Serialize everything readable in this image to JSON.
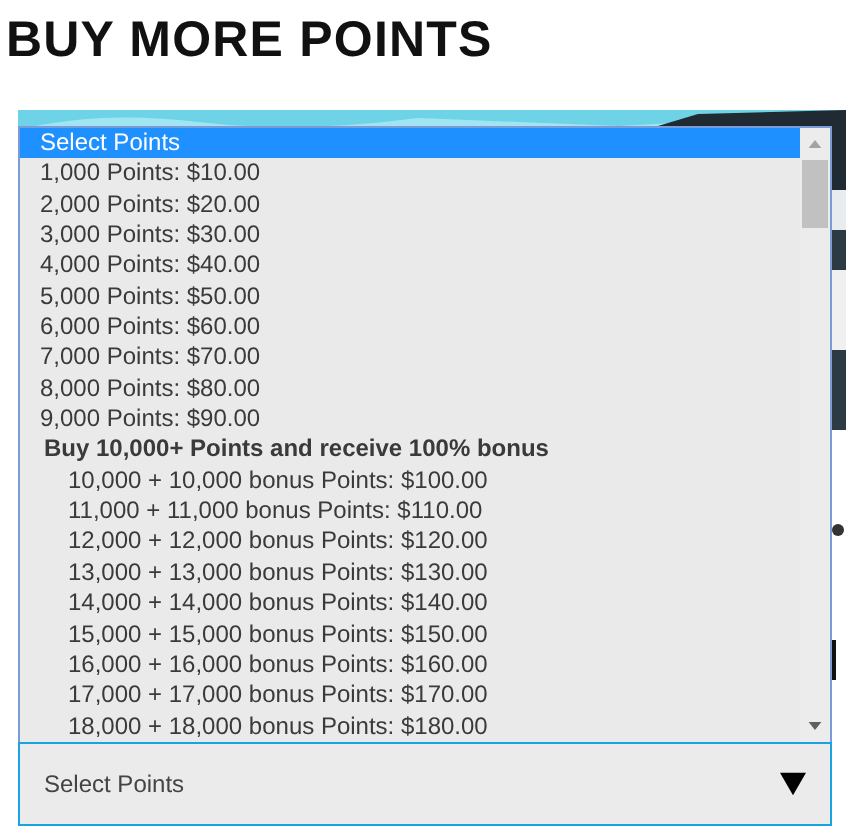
{
  "heading": "BUY MORE POINTS",
  "dropdown_list": {
    "options": [
      {
        "kind": "option",
        "label": "Select Points",
        "selected": true
      },
      {
        "kind": "option",
        "label": "1,000 Points: $10.00",
        "selected": false
      },
      {
        "kind": "option",
        "label": "2,000 Points: $20.00",
        "selected": false
      },
      {
        "kind": "option",
        "label": "3,000 Points: $30.00",
        "selected": false
      },
      {
        "kind": "option",
        "label": "4,000 Points: $40.00",
        "selected": false
      },
      {
        "kind": "option",
        "label": "5,000 Points: $50.00",
        "selected": false
      },
      {
        "kind": "option",
        "label": "6,000 Points: $60.00",
        "selected": false
      },
      {
        "kind": "option",
        "label": "7,000 Points: $70.00",
        "selected": false
      },
      {
        "kind": "option",
        "label": "8,000 Points: $80.00",
        "selected": false
      },
      {
        "kind": "option",
        "label": "9,000 Points: $90.00",
        "selected": false
      },
      {
        "kind": "group",
        "label": "Buy 10,000+ Points and receive 100% bonus",
        "children": [
          {
            "kind": "option",
            "label": "10,000 + 10,000 bonus Points: $100.00",
            "selected": false
          },
          {
            "kind": "option",
            "label": "11,000 + 11,000 bonus Points: $110.00",
            "selected": false
          },
          {
            "kind": "option",
            "label": "12,000 + 12,000 bonus Points: $120.00",
            "selected": false
          },
          {
            "kind": "option",
            "label": "13,000 + 13,000 bonus Points: $130.00",
            "selected": false
          },
          {
            "kind": "option",
            "label": "14,000 + 14,000 bonus Points: $140.00",
            "selected": false
          },
          {
            "kind": "option",
            "label": "15,000 + 15,000 bonus Points: $150.00",
            "selected": false
          },
          {
            "kind": "option",
            "label": "16,000 + 16,000 bonus Points: $160.00",
            "selected": false
          },
          {
            "kind": "option",
            "label": "17,000 + 17,000 bonus Points: $170.00",
            "selected": false
          },
          {
            "kind": "option",
            "label": "18,000 + 18,000 bonus Points: $180.00",
            "selected": false
          }
        ]
      }
    ]
  },
  "select": {
    "value": "Select Points",
    "expanded": true
  }
}
